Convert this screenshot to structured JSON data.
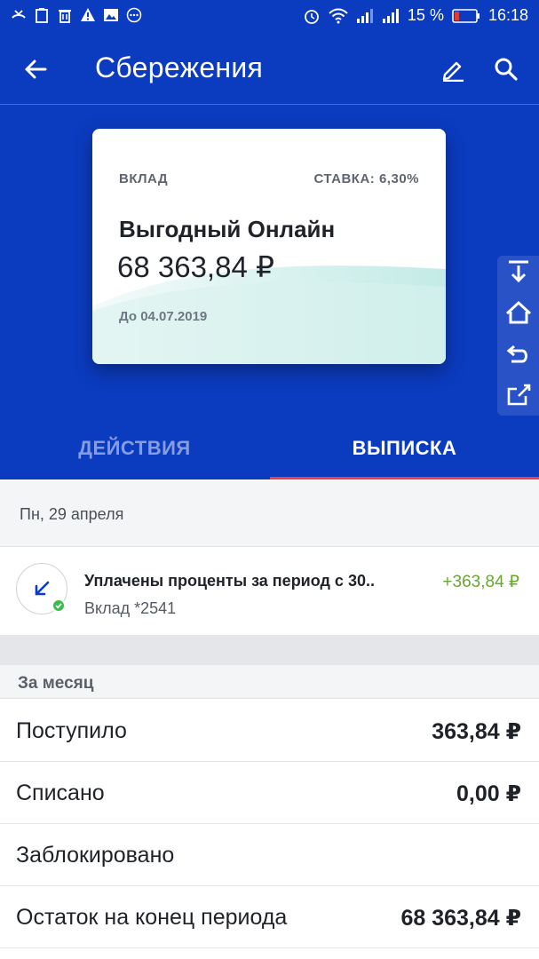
{
  "status_bar": {
    "battery": "15 %",
    "time": "16:18",
    "left_icons": [
      "missed-call-icon",
      "clipboard-icon",
      "trash-icon",
      "warning-icon",
      "image-icon",
      "more-icon"
    ],
    "right_icons": [
      "alarm-icon",
      "wifi-icon",
      "signal-icon",
      "signal-icon",
      "battery-icon"
    ]
  },
  "app_bar": {
    "title": "Сбережения",
    "icons": [
      "back-arrow-icon",
      "pencil-icon",
      "search-icon"
    ]
  },
  "card": {
    "type": "ВКЛАД",
    "rate": "СТАВКА: 6,30%",
    "name": "Выгодный Онлайн",
    "amount": "68 363,84 ₽",
    "until": "До 04.07.2019"
  },
  "side_tools": [
    "download-icon",
    "home-icon",
    "undo-icon",
    "share-icon"
  ],
  "tabs": {
    "actions": "ДЕЙСТВИЯ",
    "statement": "ВЫПИСКА",
    "active": "statement"
  },
  "statement": {
    "date": "Пн, 29 апреля",
    "transaction": {
      "title": "Уплачены проценты за период с 30..",
      "subtitle": "Вклад *2541",
      "amount": "+363,84 ₽",
      "icon": "arrow-in-icon"
    }
  },
  "summary": {
    "header": "За месяц",
    "rows": [
      {
        "label": "Поступило",
        "value": "363,84 ₽"
      },
      {
        "label": "Списано",
        "value": "0,00 ₽"
      },
      {
        "label": "Заблокировано",
        "value": ""
      },
      {
        "label": "Остаток на конец периода",
        "value": "68 363,84 ₽"
      }
    ]
  },
  "colors": {
    "brand_blue": "#0b3bbf",
    "tab_indicator": "#ef3b4b",
    "income_green": "#6aa632",
    "check_green": "#3cba4b"
  }
}
